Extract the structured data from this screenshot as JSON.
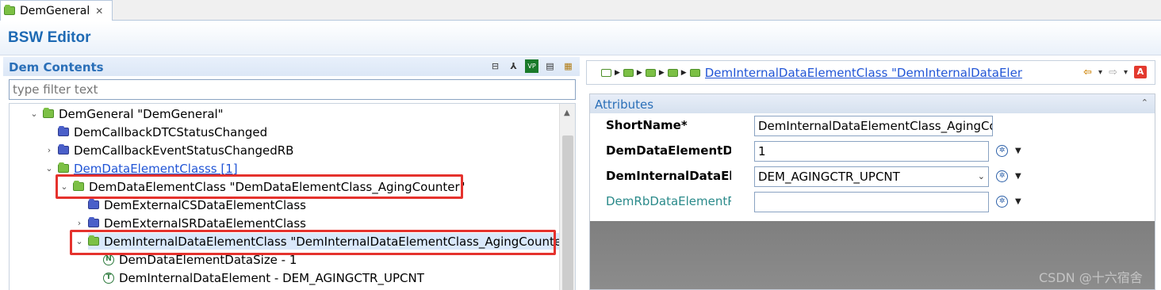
{
  "tab": {
    "label": "DemGeneral",
    "close": "✕"
  },
  "editor": {
    "title": "BSW Editor"
  },
  "left": {
    "title": "Dem Contents",
    "filter_placeholder": "type filter text",
    "toolbar": [
      {
        "name": "collapse-all-icon",
        "glyph": "⊟"
      },
      {
        "name": "hierarchy-icon",
        "glyph": "⅄"
      },
      {
        "name": "vp-res-icon",
        "glyph": "VP"
      },
      {
        "name": "document-icon",
        "glyph": "▤"
      },
      {
        "name": "table-icon",
        "glyph": "▦"
      }
    ],
    "tree": [
      {
        "label": "DemGeneral \"DemGeneral\"",
        "arrow": "⌄",
        "icon": "folder-green",
        "level": 0
      },
      {
        "label": "DemCallbackDTCStatusChanged",
        "arrow": "",
        "icon": "folder-blue",
        "level": 1
      },
      {
        "label": "DemCallbackEventStatusChangedRB",
        "arrow": "›",
        "icon": "folder-blue",
        "level": 1
      },
      {
        "label": "DemDataElementClasss [1]",
        "arrow": "⌄",
        "icon": "folder-green",
        "level": 1,
        "link": true
      },
      {
        "label": "DemDataElementClass \"DemDataElementClass_AgingCounter\"",
        "arrow": "⌄",
        "icon": "folder-green",
        "level": 2
      },
      {
        "label": "DemExternalCSDataElementClass",
        "arrow": "",
        "icon": "folder-blue",
        "level": 3
      },
      {
        "label": "DemExternalSRDataElementClass",
        "arrow": "›",
        "icon": "folder-blue",
        "level": 3
      },
      {
        "label": "DemInternalDataElementClass \"DemInternalDataElementClass_AgingCounter\"",
        "arrow": "⌄",
        "icon": "folder-green",
        "level": 3,
        "selected": true
      },
      {
        "label": "DemDataElementDataSize - 1",
        "arrow": "",
        "icon": "leaf-n",
        "glyph": "N",
        "level": 4
      },
      {
        "label": "DemInternalDataElement - DEM_AGINGCTR_UPCNT",
        "arrow": "",
        "icon": "leaf-t",
        "glyph": "T",
        "level": 4
      }
    ]
  },
  "right": {
    "breadcrumb_link": "DemInternalDataElementClass \"DemInternalDataElemer",
    "nav": {
      "back": "⇦",
      "forward": "⇨",
      "dropdown": "▾",
      "a_label": "A"
    },
    "attributes": {
      "title": "Attributes",
      "collapse": "⌃",
      "rows": [
        {
          "label": "ShortName*",
          "value": "DemInternalDataElementClass_AgingCou",
          "kind": "text"
        },
        {
          "label": "DemDataElementDat",
          "value": "1",
          "kind": "text"
        },
        {
          "label": "DemInternalDataEler",
          "value": "DEM_AGINGCTR_UPCNT",
          "kind": "combo"
        },
        {
          "label": "DemRbDataElementRe",
          "value": "",
          "kind": "text"
        }
      ]
    }
  },
  "watermark": "CSDN @十六宿舍",
  "colors": {
    "accent": "#2a6fb8",
    "highlight": "#e5322d",
    "selection": "#d9e8fb"
  }
}
